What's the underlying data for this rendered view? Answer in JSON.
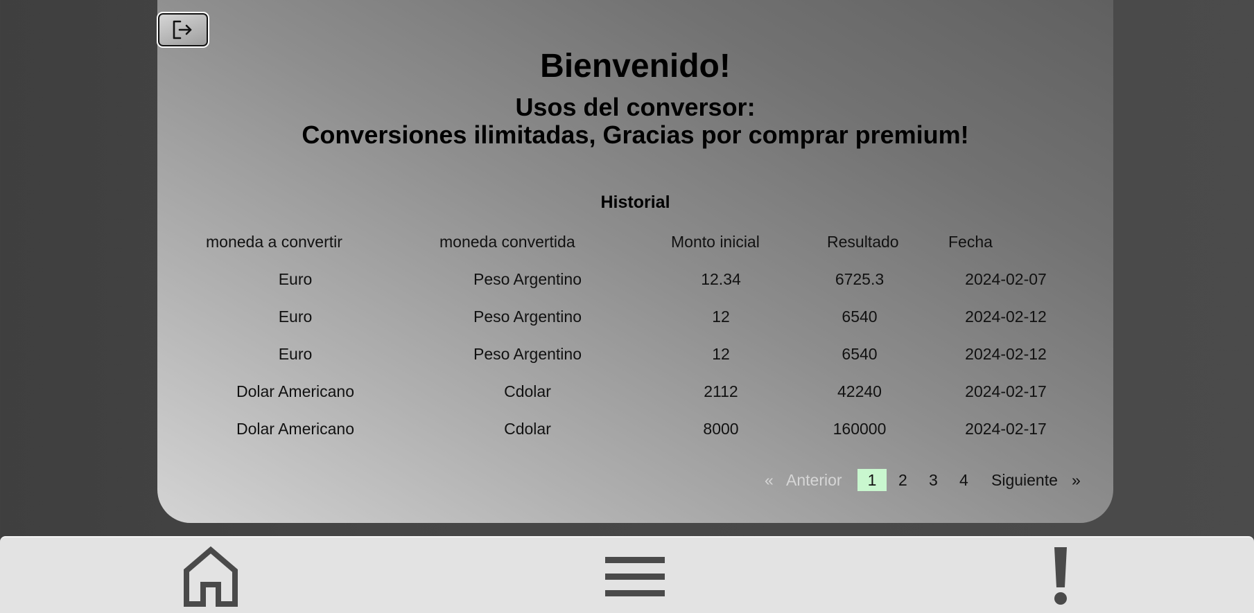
{
  "header": {
    "welcome": "Bienvenido!",
    "usage_line1": "Usos del conversor:",
    "usage_line2": "Conversiones ilimitadas, Gracias por comprar premium!"
  },
  "history": {
    "title": "Historial",
    "columns": [
      "moneda a convertir",
      "moneda convertida",
      "Monto inicial",
      "Resultado",
      "Fecha"
    ],
    "rows": [
      [
        "Euro",
        "Peso Argentino",
        "12.34",
        "6725.3",
        "2024-02-07"
      ],
      [
        "Euro",
        "Peso Argentino",
        "12",
        "6540",
        "2024-02-12"
      ],
      [
        "Euro",
        "Peso Argentino",
        "12",
        "6540",
        "2024-02-12"
      ],
      [
        "Dolar Americano",
        "Cdolar",
        "2112",
        "42240",
        "2024-02-17"
      ],
      [
        "Dolar Americano",
        "Cdolar",
        "8000",
        "160000",
        "2024-02-17"
      ]
    ]
  },
  "pagination": {
    "first": "«",
    "previous": "Anterior",
    "pages": [
      "1",
      "2",
      "3",
      "4"
    ],
    "current": "1",
    "next": "Siguiente",
    "last": "»"
  },
  "icons": {
    "logout": "logout-icon",
    "home": "home-icon",
    "menu": "menu-icon",
    "alert": "exclamation-icon"
  },
  "colors": {
    "page_background": "#454545",
    "bottom_nav": "#e3e3e3",
    "active_page": "#c9f7cf",
    "icon": "#4a4a4a"
  }
}
